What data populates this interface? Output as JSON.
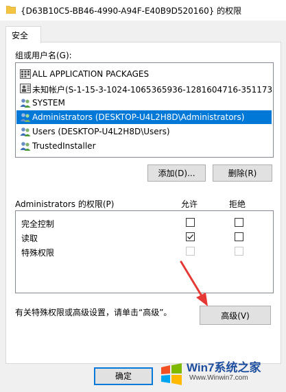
{
  "window": {
    "title": "{D63B10C5-BB46-4990-A94F-E40B9D520160} 的权限"
  },
  "tabs": [
    {
      "label": "安全"
    }
  ],
  "groups": {
    "label": "组或用户名(G):",
    "items": [
      {
        "label": "ALL APPLICATION PACKAGES",
        "icon": "app-packages-icon",
        "selected": false
      },
      {
        "label": "未知帐户(S-1-15-3-1024-1065365936-1281604716-351173...",
        "icon": "unknown-user-icon",
        "selected": false
      },
      {
        "label": "SYSTEM",
        "icon": "users-group-icon",
        "selected": false
      },
      {
        "label": "Administrators (DESKTOP-U4L2H8D\\Administrators)",
        "icon": "users-group-icon",
        "selected": true
      },
      {
        "label": "Users (DESKTOP-U4L2H8D\\Users)",
        "icon": "users-group-icon",
        "selected": false
      },
      {
        "label": "TrustedInstaller",
        "icon": "users-group-icon",
        "selected": false
      }
    ],
    "add_label": "添加(D)...",
    "remove_label": "删除(R)"
  },
  "permissions": {
    "label": "Administrators 的权限(P)",
    "allow_label": "允许",
    "deny_label": "拒绝",
    "rows": [
      {
        "name": "完全控制",
        "allow": false,
        "deny": false,
        "enabled": true
      },
      {
        "name": "读取",
        "allow": true,
        "deny": false,
        "enabled": true
      },
      {
        "name": "特殊权限",
        "allow": false,
        "deny": false,
        "enabled": false
      }
    ]
  },
  "advanced": {
    "hint": "有关特殊权限或高级设置，请单击“高级”。",
    "button_label": "高级(V)"
  },
  "footer": {
    "ok_label": "确定"
  },
  "watermark": {
    "brand": "Win7系统之家",
    "url": "Www.Winwin7.com"
  },
  "colors": {
    "selection": "#0078d7",
    "annotation_arrow": "#e53935"
  }
}
